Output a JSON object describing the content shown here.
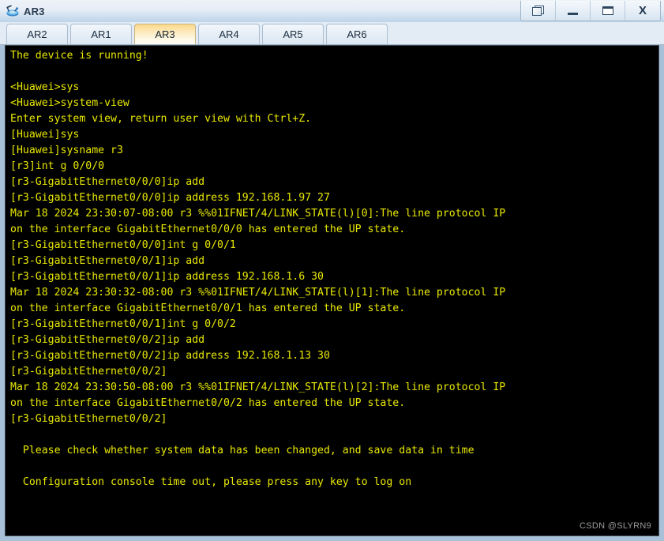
{
  "window": {
    "title": "AR3",
    "icon": "router-icon",
    "controls": [
      {
        "name": "restore-button",
        "label": "Restore",
        "glyph": "restore-icon"
      },
      {
        "name": "minimize-button",
        "label": "Minimize",
        "glyph": "minimize-icon"
      },
      {
        "name": "maximize-button",
        "label": "Maximize",
        "glyph": "maximize-icon"
      },
      {
        "name": "close-button",
        "label": "X",
        "glyph": "close-icon"
      }
    ]
  },
  "tabs": [
    {
      "label": "AR2",
      "active": false
    },
    {
      "label": "AR1",
      "active": false
    },
    {
      "label": "AR3",
      "active": true
    },
    {
      "label": "AR4",
      "active": false
    },
    {
      "label": "AR5",
      "active": false
    },
    {
      "label": "AR6",
      "active": false
    }
  ],
  "terminal": {
    "foreground": "#e8e800",
    "background": "#000000",
    "lines": [
      "The device is running!",
      "",
      "<Huawei>sys",
      "<Huawei>system-view",
      "Enter system view, return user view with Ctrl+Z.",
      "[Huawei]sys",
      "[Huawei]sysname r3",
      "[r3]int g 0/0/0",
      "[r3-GigabitEthernet0/0/0]ip add",
      "[r3-GigabitEthernet0/0/0]ip address 192.168.1.97 27",
      "Mar 18 2024 23:30:07-08:00 r3 %%01IFNET/4/LINK_STATE(l)[0]:The line protocol IP",
      "on the interface GigabitEthernet0/0/0 has entered the UP state.",
      "[r3-GigabitEthernet0/0/0]int g 0/0/1",
      "[r3-GigabitEthernet0/0/1]ip add",
      "[r3-GigabitEthernet0/0/1]ip address 192.168.1.6 30",
      "Mar 18 2024 23:30:32-08:00 r3 %%01IFNET/4/LINK_STATE(l)[1]:The line protocol IP",
      "on the interface GigabitEthernet0/0/1 has entered the UP state.",
      "[r3-GigabitEthernet0/0/1]int g 0/0/2",
      "[r3-GigabitEthernet0/0/2]ip add",
      "[r3-GigabitEthernet0/0/2]ip address 192.168.1.13 30",
      "[r3-GigabitEthernet0/0/2]",
      "Mar 18 2024 23:30:50-08:00 r3 %%01IFNET/4/LINK_STATE(l)[2]:The line protocol IP",
      "on the interface GigabitEthernet0/0/2 has entered the UP state.",
      "[r3-GigabitEthernet0/0/2]",
      "",
      "  Please check whether system data has been changed, and save data in time",
      "",
      "  Configuration console time out, please press any key to log on"
    ]
  },
  "watermark": {
    "text": "CSDN @SLYRN9"
  }
}
